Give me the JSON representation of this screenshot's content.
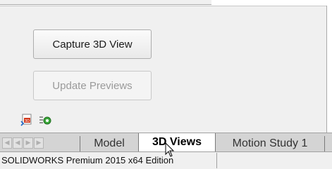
{
  "buttons": {
    "capture_label": "Capture 3D View",
    "update_label": "Update Previews"
  },
  "icons": {
    "view_icon": "3d-view-icon",
    "list_icon": "list-settings-icon"
  },
  "tabs": [
    {
      "label": "Model",
      "active": false
    },
    {
      "label": "3D Views",
      "active": true
    },
    {
      "label": "Motion Study 1",
      "active": false
    }
  ],
  "status_bar": {
    "text": "SOLIDWORKS Premium 2015 x64 Edition"
  },
  "colors": {
    "panel_bg": "#f0f0f0",
    "active_tab_bg": "#ffffff",
    "disabled_text": "#9a9a9a"
  }
}
